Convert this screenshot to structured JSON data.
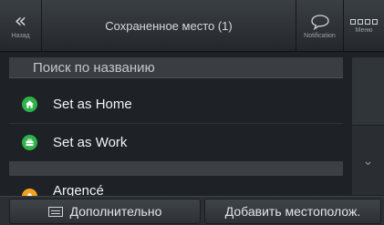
{
  "header": {
    "back_label": "Назад",
    "title": "Сохраненное место (1)",
    "notification_label": "Notification",
    "menu_label": "Меню"
  },
  "search": {
    "placeholder": "Поиск по названию"
  },
  "list": {
    "items": [
      {
        "label": "Set as Home",
        "icon": "home-icon",
        "color": "#2eb24a"
      },
      {
        "label": "Set as Work",
        "icon": "briefcase-icon",
        "color": "#2eb24a"
      },
      {
        "label": "Argencé",
        "icon": "location-icon",
        "color": "#f2a21e"
      }
    ]
  },
  "bottom_bar": {
    "more_label": "Дополнительно",
    "add_label": "Добавить местополож."
  }
}
